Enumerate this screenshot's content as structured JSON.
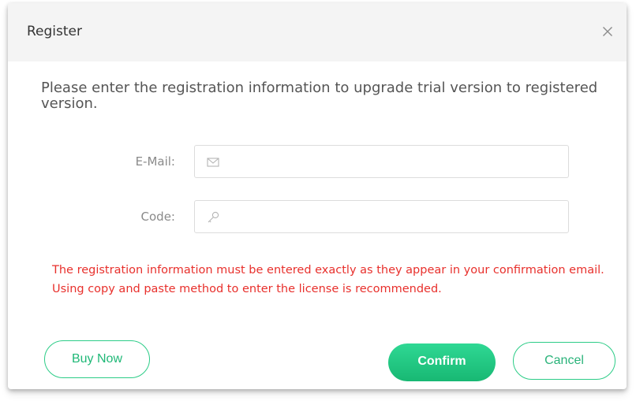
{
  "dialog": {
    "title": "Register",
    "intro": "Please enter the registration information to upgrade trial version to registered version.",
    "warning": "The registration information must be entered exactly as they appear in your confirmation email. Using copy and paste method to enter the license is recommended."
  },
  "fields": {
    "email": {
      "label": "E-Mail:",
      "value": "",
      "placeholder": "",
      "icon": "mail-icon"
    },
    "code": {
      "label": "Code:",
      "value": "",
      "placeholder": "",
      "icon": "key-icon"
    }
  },
  "buttons": {
    "buy_now": "Buy Now",
    "confirm": "Confirm",
    "cancel": "Cancel"
  },
  "colors": {
    "accent": "#20c27c",
    "warning": "#e8302c",
    "titlebar": "#f4f4f4"
  }
}
